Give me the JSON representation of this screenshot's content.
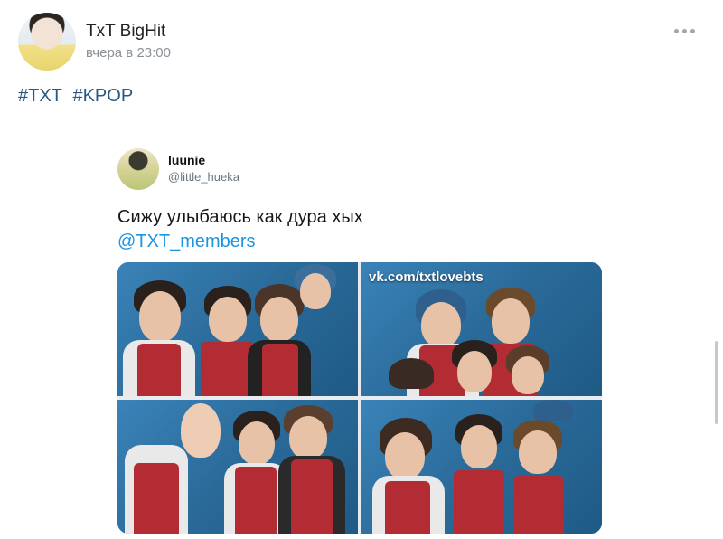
{
  "post": {
    "author": "TxT BigHit",
    "time": "вчера в 23:00",
    "hashtags": [
      "#TXT",
      "#KPOP"
    ]
  },
  "tweet": {
    "name": "luunie",
    "handle": "@little_hueka",
    "text": "Сижу улыбаюсь как дура хых",
    "mention": "@TXT_members",
    "watermark": "vk.com/txtlovebts"
  },
  "icons": {
    "more": "more-horizontal-icon"
  },
  "colors": {
    "link": "#2a5885",
    "mention": "#1b95e0",
    "jersey": "#b32b33",
    "photo_bg": "#2d6f9e"
  }
}
